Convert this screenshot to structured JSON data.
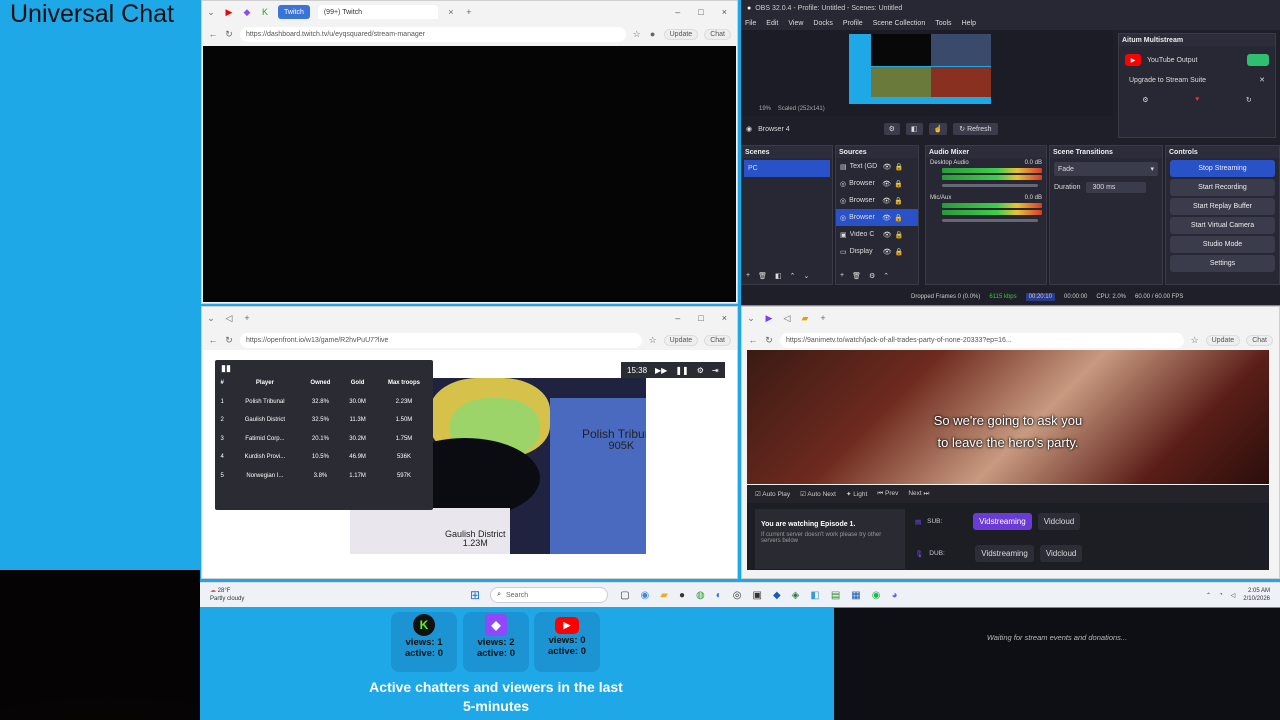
{
  "universal_chat_title": "Universal Chat",
  "twitch_browser": {
    "tab_twitch": "Twitch",
    "tab_title": "(99+) Twitch",
    "url": "https://dashboard.twitch.tv/u/eyqsquared/stream-manager",
    "update_label": "Update",
    "chat_label": "Chat"
  },
  "obs": {
    "title": "OBS 32.0.4 - Profile: Untitled - Scenes: Untitled",
    "menu": [
      "File",
      "Edit",
      "View",
      "Docks",
      "Profile",
      "Scene Collection",
      "Tools",
      "Help"
    ],
    "preview_zoom": "19%",
    "preview_scale": "Scaled (252x141)",
    "source_name": "Browser 4",
    "refresh_label": "Refresh",
    "multistream_title": "Aitum Multistream",
    "youtube_output": "YouTube Output",
    "upgrade_label": "Upgrade to Stream Suite",
    "docks": {
      "scenes": "Scenes",
      "sources": "Sources",
      "audio_mixer": "Audio Mixer",
      "transitions": "Scene Transitions",
      "controls": "Controls"
    },
    "scene_item": "PC",
    "sources": [
      "Text (GD",
      "Browser",
      "Browser",
      "Browser",
      "Video C",
      "Display"
    ],
    "audio": [
      {
        "name": "Desktop Audio",
        "db": "0.0 dB"
      },
      {
        "name": "Mic/Aux",
        "db": "0.0 dB"
      }
    ],
    "transition": "Fade",
    "duration_label": "Duration",
    "duration_value": "300 ms",
    "controls": [
      "Stop Streaming",
      "Start Recording",
      "Start Replay Buffer",
      "Start Virtual Camera",
      "Studio Mode",
      "Settings"
    ],
    "status": {
      "dropped": "Dropped Frames 0 (0.0%)",
      "bitrate": "6115 kbps",
      "live_time": "00:20:10",
      "rec_time": "00:00:00",
      "cpu": "CPU: 2.0%",
      "fps": "60.00 / 60.00 FPS"
    }
  },
  "game_browser": {
    "url": "https://openfront.io/w13/game/R2hvPuU7?live",
    "timer": "15:38",
    "update_label": "Update",
    "chat_label": "Chat",
    "leaderboard": {
      "headers": [
        "#",
        "Player",
        "Owned",
        "Gold",
        "Max troops"
      ],
      "rows": [
        [
          "1",
          "Polish Tribunal",
          "32.8%",
          "30.0M",
          "2.23M"
        ],
        [
          "2",
          "Gaulish District",
          "32.5%",
          "11.3M",
          "1.50M"
        ],
        [
          "3",
          "Fatimid Corp...",
          "20.1%",
          "30.2M",
          "1.75M"
        ],
        [
          "4",
          "Kurdish Provi...",
          "10.5%",
          "46.9M",
          "536K"
        ],
        [
          "5",
          "Norwegian I...",
          "3.8%",
          "1.17M",
          "597K"
        ]
      ]
    },
    "map_labels": [
      {
        "name": "Polish Tribunal",
        "value": "905K"
      },
      {
        "name": "Gaulish District",
        "value": "1.23M"
      }
    ]
  },
  "anime_browser": {
    "url": "https://9animetv.to/watch/jack-of-all-trades-party-of-none-20333?ep=16...",
    "update_label": "Update",
    "chat_label": "Chat",
    "subtitle_line1": "So we're going to ask you",
    "subtitle_line2": "to leave the hero's party.",
    "toolbar": [
      "Auto Play",
      "Auto Next",
      "Light",
      "Prev",
      "Next"
    ],
    "watching": "You are watching Episode 1.",
    "hint": "If current server doesn't work please try other servers below",
    "sub_label": "SUB:",
    "dub_label": "DUB:",
    "servers": [
      "Vidstreaming",
      "Vidcloud"
    ]
  },
  "taskbar": {
    "weather_temp": "28°F",
    "weather_desc": "Partly cloudy",
    "search_placeholder": "Search",
    "time": "2:05 AM",
    "date": "2/10/2026"
  },
  "viewers": {
    "cards": [
      {
        "platform": "kick",
        "views": "views: 1",
        "active": "active: 0",
        "color": "#53fc18"
      },
      {
        "platform": "twitch",
        "views": "views: 2",
        "active": "active: 0",
        "color": "#9146ff"
      },
      {
        "platform": "youtube",
        "views": "views: 0",
        "active": "active: 0",
        "color": "#ff0000"
      }
    ],
    "active_line1": "Active chatters and viewers in the last",
    "active_line2": "5-minutes"
  },
  "events_message": "Waiting for stream events and donations..."
}
